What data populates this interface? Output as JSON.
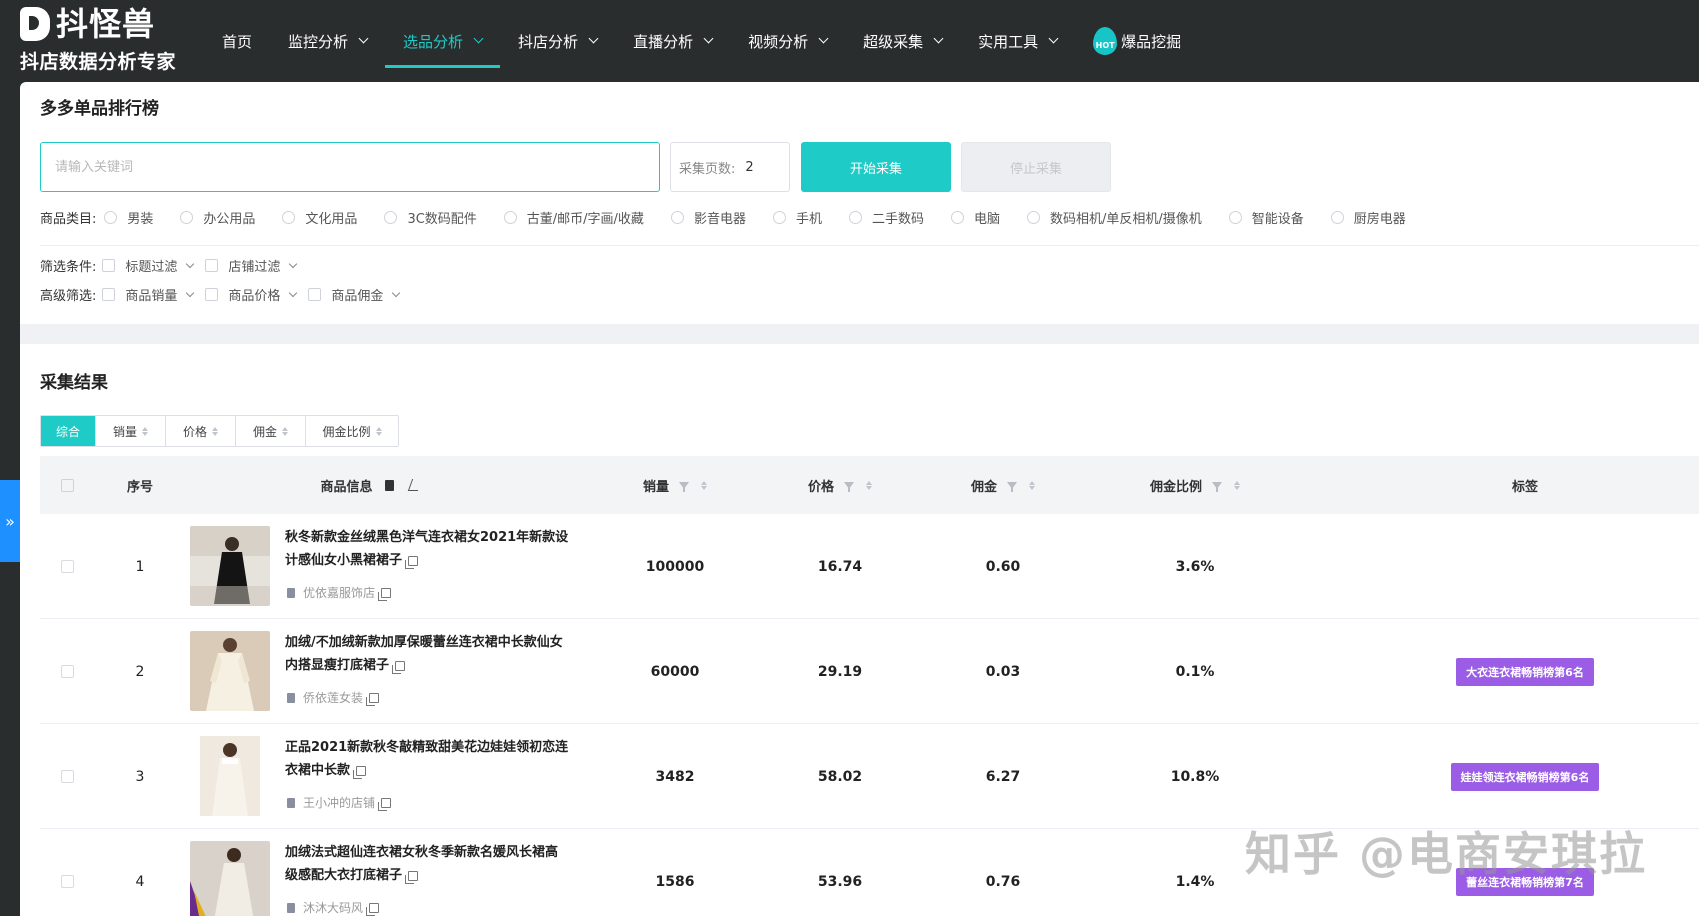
{
  "brand": {
    "name": "抖怪兽",
    "subtitle": "抖店数据分析专家"
  },
  "nav": {
    "items": [
      {
        "label": "首页",
        "dropdown": false
      },
      {
        "label": "监控分析",
        "dropdown": true
      },
      {
        "label": "选品分析",
        "dropdown": true,
        "active": true
      },
      {
        "label": "抖店分析",
        "dropdown": true
      },
      {
        "label": "直播分析",
        "dropdown": true
      },
      {
        "label": "视频分析",
        "dropdown": true
      },
      {
        "label": "超级采集",
        "dropdown": true
      },
      {
        "label": "实用工具",
        "dropdown": true
      }
    ],
    "hot": {
      "badge": "HOT",
      "label": "爆品挖掘"
    }
  },
  "search_panel": {
    "title": "多多单品排行榜",
    "keyword_placeholder": "请输入关键词",
    "keyword_value": "",
    "pages_label": "采集页数:",
    "pages_value": "2",
    "start_label": "开始采集",
    "stop_label": "停止采集",
    "category_label": "商品类目:",
    "categories": [
      "男装",
      "办公用品",
      "文化用品",
      "3C数码配件",
      "古董/邮币/字画/收藏",
      "影音电器",
      "手机",
      "二手数码",
      "电脑",
      "数码相机/单反相机/摄像机",
      "智能设备",
      "厨房电器"
    ],
    "filter_label": "筛选条件:",
    "filters": [
      "标题过滤",
      "店铺过滤"
    ],
    "advanced_label": "高级筛选:",
    "advanced": [
      "商品销量",
      "商品价格",
      "商品佣金"
    ]
  },
  "results": {
    "title": "采集结果",
    "sort_tabs": [
      {
        "label": "综合",
        "active": true
      },
      {
        "label": "销量"
      },
      {
        "label": "价格"
      },
      {
        "label": "佣金"
      },
      {
        "label": "佣金比例"
      }
    ],
    "columns": {
      "index": "序号",
      "product": "商品信息",
      "sales": "销量",
      "price": "价格",
      "commission": "佣金",
      "commission_rate": "佣金比例",
      "tags": "标签"
    },
    "rows": [
      {
        "index": "1",
        "title": "秋冬新款金丝绒黑色洋气连衣裙女2021年新款设计感仙女小黑裙裙子",
        "shop": "优依嘉服饰店",
        "sales": "100000",
        "price": "16.74",
        "commission": "0.60",
        "rate": "3.6%",
        "tag": ""
      },
      {
        "index": "2",
        "title": "加绒/不加绒新款加厚保暖蕾丝连衣裙中长款仙女内搭显瘦打底裙子",
        "shop": "侨依莲女装",
        "sales": "60000",
        "price": "29.19",
        "commission": "0.03",
        "rate": "0.1%",
        "tag": "大衣连衣裙畅销榜第6名"
      },
      {
        "index": "3",
        "title": "正品2021新款秋冬敲精致甜美花边娃娃领初恋连衣裙中长款",
        "shop": "王小冲的店铺",
        "sales": "3482",
        "price": "58.02",
        "commission": "6.27",
        "rate": "10.8%",
        "tag": "娃娃领连衣裙畅销榜第6名"
      },
      {
        "index": "4",
        "title": "加绒法式超仙连衣裙女秋冬季新款名媛风长裙高级感配大衣打底裙子",
        "shop": "沐沐大码风",
        "sales": "1586",
        "price": "53.96",
        "commission": "0.76",
        "rate": "1.4%",
        "tag": "蕾丝连衣裙畅销榜第7名"
      }
    ]
  },
  "watermark": "知乎 @电商安琪拉",
  "colors": {
    "accent": "#1ecbc7",
    "nav_bg": "#2a2d2e",
    "tag_purple": "#9b5de5",
    "side_tab": "#1e90ff"
  },
  "icons": {
    "side_tab": "double-chevron-right-icon",
    "nav_dropdown": "chevron-down-icon",
    "copy": "copy-icon",
    "shop": "shop-icon",
    "filter": "filter-icon"
  }
}
